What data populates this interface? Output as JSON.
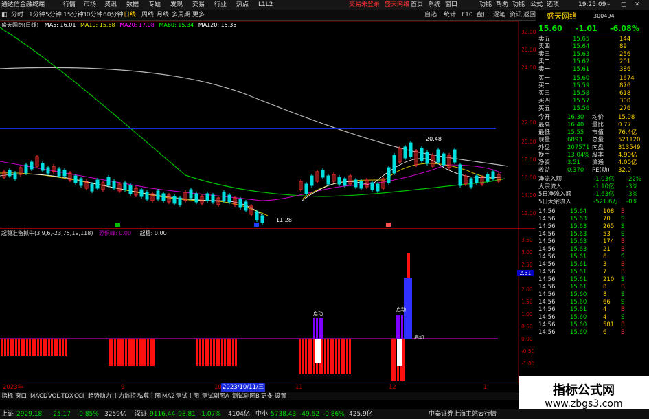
{
  "window": {
    "title": "通达信金融终端",
    "menu": [
      "行情",
      "市场",
      "资讯",
      "数据",
      "专题",
      "发现",
      "交易",
      "行业",
      "热点"
    ],
    "tip": "L1L2",
    "broker": "交易未登录",
    "broker2": "盛天网络",
    "right_menu": [
      "首页",
      "系统",
      "窗口",
      "功能",
      "帮助",
      "功能",
      "公式",
      "选项",
      "19:25:09"
    ]
  },
  "toolbar": {
    "periods": [
      "分时",
      "1分钟",
      "5分钟",
      "15分钟",
      "30分钟",
      "60分钟",
      "日线",
      "周线",
      "月线",
      "多周期",
      "更多"
    ],
    "active": "日线",
    "right": [
      "自选",
      "统计",
      "F10",
      "盘口",
      "逐笔",
      "资讯",
      "返回"
    ]
  },
  "main_chart": {
    "stock_title": "盛天网络(日线)",
    "ma": [
      {
        "label": "MA5: 16.01",
        "color": "#ffffff"
      },
      {
        "label": "MA10: 15.68",
        "color": "#e8e000"
      },
      {
        "label": "MA20: 17.08",
        "color": "#ff00ff"
      },
      {
        "label": "MA60: 15.34",
        "color": "#00ff00"
      },
      {
        "label": "MA120: 15.35",
        "color": "#ffffff"
      }
    ],
    "price_axis": [
      "32.00",
      "26.00",
      "24.00",
      "22.00",
      "20.00",
      "18.00",
      "16.00",
      "14.00",
      "12.00"
    ],
    "annotations": {
      "high": "20.48",
      "low": "11.28"
    }
  },
  "indicator": {
    "title": "起稳准备抓牛(3,9,6,-23,75,19,118)",
    "label2": "恐惧峰: 0.00",
    "label3": "起稳: 0.00",
    "axis": [
      "3.50",
      "3.00",
      "2.50",
      "2.00",
      "1.50",
      "1.00",
      "0.50",
      "0.00",
      "-0.50",
      "-1.00"
    ],
    "marker": "2.31",
    "tag": "启动"
  },
  "date_axis": [
    "2023年",
    "9",
    "10",
    "2023/10/11/三",
    "11",
    "12",
    "1"
  ],
  "bottom_tabs": [
    "指标",
    "窗口",
    "MACD",
    "VOL-TDX",
    "CCI",
    "趋势动力",
    "主力监控",
    "私募主图",
    "MA2",
    "测试主图",
    "测试副图A",
    "测试副图B",
    "更多",
    "设置"
  ],
  "status": [
    {
      "label": "上证",
      "value": "2929.18",
      "chg": "-25.17",
      "pct": "-0.85%",
      "amt": "3259亿"
    },
    {
      "label": "深证",
      "value": "9116.44",
      "chg": "-98.81",
      "pct": "-1.07%",
      "amt": "4104亿"
    },
    {
      "label": "中小",
      "value": "5738.43",
      "chg": "-49.62",
      "pct": "-0.86%",
      "amt": "425.9亿"
    }
  ],
  "status_right": "中泰证券上海主站云行情",
  "quote": {
    "name": "盛天网络",
    "code": "300494",
    "price": "15.60",
    "change": "-1.01",
    "pct": "-6.08%",
    "asks": [
      {
        "label": "卖五",
        "price": "15.65",
        "vol": "144"
      },
      {
        "label": "卖四",
        "price": "15.64",
        "vol": "89"
      },
      {
        "label": "卖三",
        "price": "15.63",
        "vol": "256"
      },
      {
        "label": "卖二",
        "price": "15.62",
        "vol": "201"
      },
      {
        "label": "卖一",
        "price": "15.61",
        "vol": "386"
      }
    ],
    "bids": [
      {
        "label": "买一",
        "price": "15.60",
        "vol": "1674"
      },
      {
        "label": "买二",
        "price": "15.59",
        "vol": "876"
      },
      {
        "label": "买三",
        "price": "15.58",
        "vol": "618"
      },
      {
        "label": "买四",
        "price": "15.57",
        "vol": "300"
      },
      {
        "label": "买五",
        "price": "15.56",
        "vol": "276"
      }
    ],
    "stats": [
      {
        "l1": "今开",
        "v1": "16.30",
        "l2": "均价",
        "v2": "15.98"
      },
      {
        "l1": "最高",
        "v1": "16.40",
        "l2": "量比",
        "v2": "0.77"
      },
      {
        "l1": "最低",
        "v1": "15.55",
        "l2": "市值",
        "v2": "76.4亿"
      },
      {
        "l1": "现量",
        "v1": "6893",
        "l2": "总量",
        "v2": "521120"
      },
      {
        "l1": "外盘",
        "v1": "207571",
        "l2": "内盘",
        "v2": "313549"
      },
      {
        "l1": "换手",
        "v1": "13.04%",
        "l2": "股本",
        "v2": "4.90亿"
      },
      {
        "l1": "净资",
        "v1": "3.51",
        "l2": "流通",
        "v2": "4.00亿"
      },
      {
        "l1": "收益",
        "v1": "0.370",
        "l2": "PE(动)",
        "v2": "32.0"
      }
    ],
    "flows": [
      {
        "label": "净流入额",
        "value": "-1.03亿",
        "pct": "-22%"
      },
      {
        "label": "大宗流入",
        "value": "-1.10亿",
        "pct": "-3%"
      },
      {
        "label": "5日净流入额",
        "value": "-1.63亿",
        "pct": "-3%"
      },
      {
        "label": "5日大宗流入",
        "value": "-521.6万",
        "pct": "-0%"
      }
    ],
    "ticks": [
      {
        "t": "14:56",
        "p": "15.64",
        "v": "108",
        "s": "B"
      },
      {
        "t": "14:56",
        "p": "15.63",
        "v": "70",
        "s": "S"
      },
      {
        "t": "14:56",
        "p": "15.63",
        "v": "265",
        "s": "S"
      },
      {
        "t": "14:56",
        "p": "15.63",
        "v": "53",
        "s": "S"
      },
      {
        "t": "14:56",
        "p": "15.63",
        "v": "174",
        "s": "B"
      },
      {
        "t": "14:56",
        "p": "15.63",
        "v": "21",
        "s": "B"
      },
      {
        "t": "14:56",
        "p": "15.61",
        "v": "6",
        "s": "S"
      },
      {
        "t": "14:56",
        "p": "15.61",
        "v": "3",
        "s": "B"
      },
      {
        "t": "14:56",
        "p": "15.61",
        "v": "7",
        "s": "B"
      },
      {
        "t": "14:56",
        "p": "15.61",
        "v": "210",
        "s": "S"
      },
      {
        "t": "14:56",
        "p": "15.61",
        "v": "8",
        "s": "B"
      },
      {
        "t": "14:56",
        "p": "15.60",
        "v": "8",
        "s": "S"
      },
      {
        "t": "14:56",
        "p": "15.60",
        "v": "66",
        "s": "S"
      },
      {
        "t": "14:56",
        "p": "15.61",
        "v": "4",
        "s": "B"
      },
      {
        "t": "14:56",
        "p": "15.60",
        "v": "4",
        "s": "S"
      },
      {
        "t": "14:56",
        "p": "15.60",
        "v": "581",
        "s": "B"
      },
      {
        "t": "14:56",
        "p": "15.60",
        "v": "6",
        "s": "B"
      }
    ]
  },
  "watermark": {
    "title": "指标公式网",
    "url": "www.zbgs3.com"
  },
  "colors": {
    "up": "#ff3030",
    "down": "#00e0e0",
    "ma5": "#ffffff",
    "ma60": "#00c000",
    "ma120": "#b0b0b0",
    "ind_pos": "#8000ff",
    "ind_neg": "#ff1010"
  }
}
